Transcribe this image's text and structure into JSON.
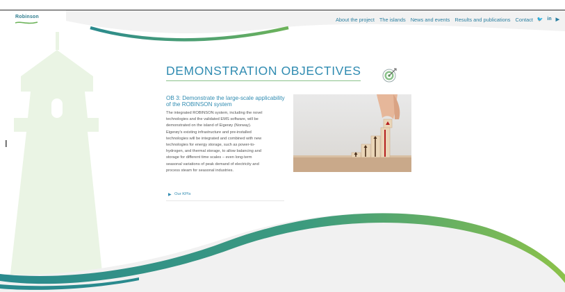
{
  "header": {
    "logo_text": "Robinson",
    "nav": [
      "About the project",
      "The islands",
      "News and events",
      "Results and publications",
      "Contact"
    ],
    "social": [
      "twitter-icon",
      "linkedin-icon",
      "youtube-icon"
    ],
    "social_glyphs": [
      "🐦",
      "in",
      "▶"
    ]
  },
  "main": {
    "title": "DEMONSTRATION OBJECTIVES",
    "objective_title": "OB 3: Demonstrate the large-scale applicability of the ROBINSON system",
    "body_lines": [
      "The integrated ROBINSON system, including the novel",
      "technologies and the validated EMS software, will be",
      "demonstrated on the island of Eigerøy (Norway).",
      "Eigerøy's existing infrastructure and pre-installed",
      "technologies will be integrated and combined with new",
      "technologies for energy storage, such as power-to-",
      "hydrogen, and thermal storage, to allow balancing and",
      "storage for different time scales – even long-term",
      "seasonal variations of peak demand of electricity and",
      "process steam for seasonal industries."
    ],
    "kpi_link": "Our KPIs"
  },
  "colors": {
    "accent_blue": "#2f8bb1",
    "teal": "#2f7d8f",
    "green": "#8ac28a",
    "lighthouse": "#eaf4e4"
  }
}
